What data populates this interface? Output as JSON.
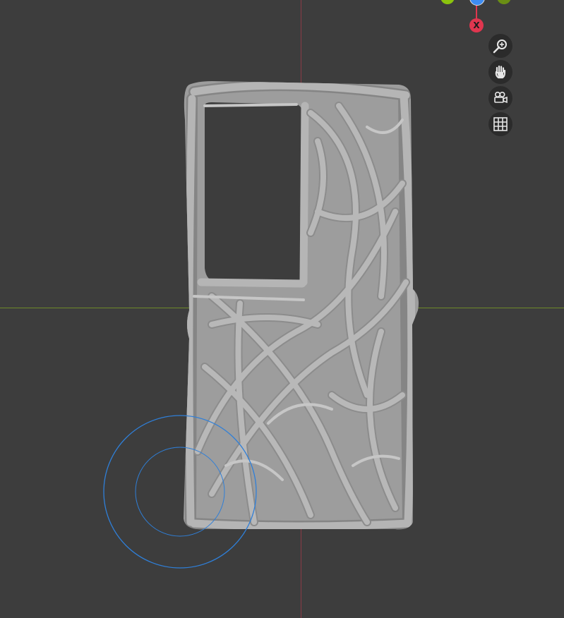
{
  "viewport": {
    "background": "#3d3d3d",
    "x_axis_color": "#6e8a2a",
    "y_axis_color": "#8a3a46"
  },
  "gizmo": {
    "x_label": "X",
    "x_color": "#e0364f",
    "y_color": "#8bc40d",
    "z_color": "#3d8cf2",
    "neg_y_color": "#6a8e14"
  },
  "navigation": {
    "buttons": [
      {
        "name": "zoom-button",
        "icon": "magnifier-plus-icon"
      },
      {
        "name": "pan-button",
        "icon": "hand-icon"
      },
      {
        "name": "camera-view-button",
        "icon": "movie-camera-icon"
      },
      {
        "name": "orthographic-toggle-button",
        "icon": "grid-icon"
      }
    ]
  },
  "model": {
    "object": "organic-vine-phone-case",
    "mesh_color": "#a9a9a9",
    "cavity_color": "#9b9b9b"
  },
  "brush": {
    "color": "#2f7fd8"
  }
}
